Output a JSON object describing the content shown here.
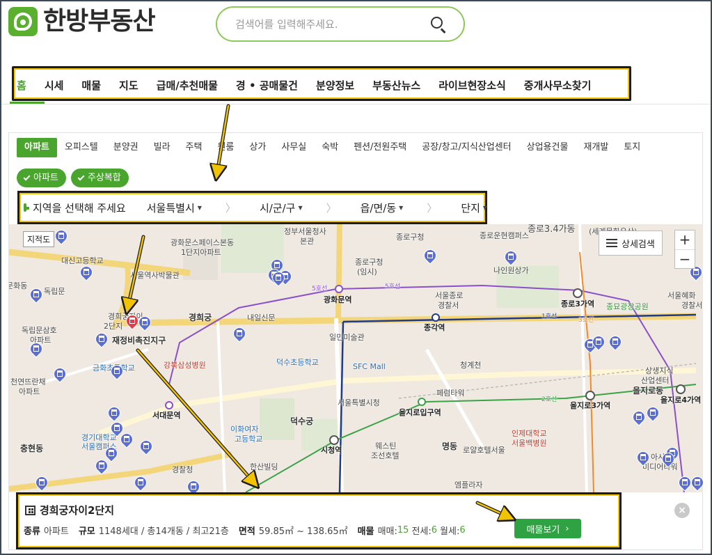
{
  "logo": {
    "text": "한방부동산"
  },
  "search": {
    "placeholder": "검색어를 입력해주세요."
  },
  "nav": {
    "items": [
      "홈",
      "시세",
      "매물",
      "지도",
      "급매/추천매물",
      "경 • 공매물건",
      "분양정보",
      "부동산뉴스",
      "라이브현장소식",
      "중개사무소찾기"
    ],
    "active_index": 0
  },
  "categories": {
    "items": [
      "아파트",
      "오피스텔",
      "분양권",
      "빌라",
      "주택",
      "원룸",
      "상가",
      "사무실",
      "숙박",
      "펜션/전원주택",
      "공장/창고/지식산업센터",
      "상업용건물",
      "재개발",
      "토지"
    ],
    "active_index": 0
  },
  "chips": [
    "아파트",
    "주상복합"
  ],
  "region": {
    "label": "지역을 선택해 주세요",
    "city": "서울특별시",
    "district": "시/군/구",
    "town": "읍/면/동",
    "complex": "단지"
  },
  "map": {
    "cadastral": "지적도",
    "detail_search": "상세검색",
    "zoom_in": "+",
    "zoom_out": "−",
    "labels": {
      "l1": "정부서울청사",
      "l2": "본관",
      "l3": "광화문스페이스본동",
      "l4": "1단지아파트",
      "l5": "대신고등학교",
      "l6": "독립문",
      "l7": "독립문삼호",
      "l8": "아파트",
      "l9": "천연뜨란채",
      "l10": "아파트",
      "l11": "경희궁",
      "l12": "경희궁자이",
      "l13": "2단지",
      "l14": "재정비촉진지구",
      "l15": "금화초등학교",
      "l16": "강북삼성병원",
      "l17": "서대문역",
      "l18": "충현동",
      "l19": "경기대학교",
      "l20": "서울캠퍼스",
      "l21": "경찰청",
      "l22": "이화여자",
      "l23": "고등학교",
      "l24": "덕수궁",
      "l25": "덕수초등학교",
      "l26": "광화문역",
      "l27": "종로구청",
      "l28": "(임시)",
      "l29": "서울종로",
      "l30": "경찰서",
      "l31": "종각역",
      "l32": "일민미술관",
      "l33": "SFC Mall",
      "l34": "청계천",
      "l35": "페럼타워",
      "l36": "서울특별시청",
      "l37": "을지로입구역",
      "l38": "시청역",
      "l39": "웨스틴",
      "l40": "조선호텔",
      "l41": "명동",
      "l42": "로얄호텔서울",
      "l43": "엠플라자",
      "l44": "인제대학교",
      "l45": "서울백병원",
      "l46": "종로3가역",
      "l47": "종묘광장공원",
      "l48": "을지로3가역",
      "l49": "을지로4가역",
      "l50": "상생지식",
      "l51": "산업센터",
      "l52": "을지로동",
      "l53": "아시아",
      "l54": "미디어타워",
      "l55": "내일신문",
      "l56": "한산빌딩",
      "l57": "종로운현캠퍼스",
      "l58": "나인원상가",
      "l59": "서울혜화",
      "l60": "경찰서",
      "l61": "5호선",
      "l62": "5호선",
      "l63": "1호선",
      "l64": "2호선",
      "l65": "3호선",
      "l66": "종로3.4가동",
      "l67": "(세계문화유산)",
      "l68": "문화동",
      "l69": "서울역사박물관",
      "l70": "종로구청"
    }
  },
  "card": {
    "title": "경희궁자이2단지",
    "type_key": "종류",
    "type_val": "아파트",
    "scale_key": "규모",
    "scale_val": "1148세대 / 총14개동 / 최고21층",
    "area_key": "면적",
    "area_val": "59.85㎡ ~ 138.65㎡",
    "listing_key": "매물",
    "sale_label": "매매:",
    "sale_count": "15",
    "jeonse_label": "전세:",
    "jeonse_count": "6",
    "monthly_label": "월세:",
    "monthly_count": "6",
    "button": "매물보기",
    "button_arrow": "›",
    "close": "×"
  },
  "colors": {
    "brand_green": "#4aa52e",
    "highlight_yellow": "#f2c300",
    "pin_blue": "#5b6fd3",
    "pin_red": "#e23b4a"
  },
  "icons": [
    "search-icon",
    "home-icon",
    "check-icon",
    "filter-icon",
    "building-icon",
    "close-icon",
    "chevron-right-icon"
  ]
}
